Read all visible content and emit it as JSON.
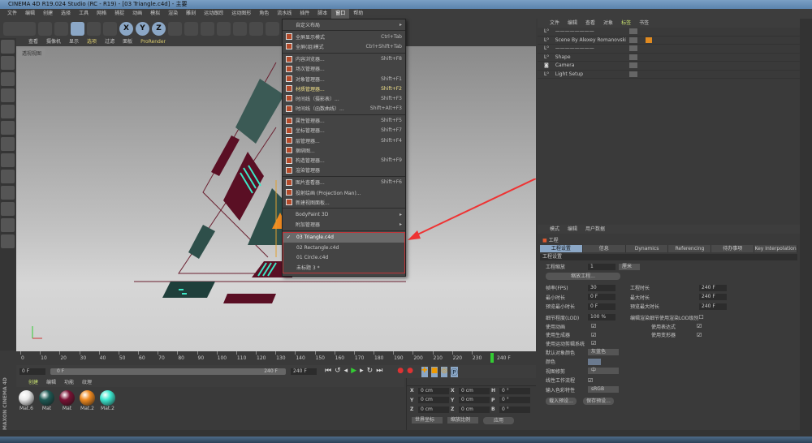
{
  "title": "CINEMA 4D R19.024 Studio (RC - R19) - [03 Triangle.c4d] - 主要",
  "menubar": [
    "文件",
    "编辑",
    "创建",
    "选择",
    "工具",
    "网格",
    "捕捉",
    "动画",
    "模拟",
    "渲染",
    "雕刻",
    "运动跟踪",
    "运动图形",
    "角色",
    "流水线",
    "插件",
    "脚本",
    "窗口",
    "帮助"
  ],
  "active_menu": "窗口",
  "toolbar": {
    "axes": [
      "X",
      "Y",
      "Z"
    ]
  },
  "viewport": {
    "menu": [
      "查看",
      "摄像机",
      "显示",
      "选项",
      "过滤",
      "面板",
      "ProRender"
    ],
    "label": "透视视图",
    "colors": {
      "maroon": "#5a0f24",
      "teal": "#2e4f4a",
      "cyan": "#3de8c6",
      "orange": "#f08a20"
    }
  },
  "window_menu": {
    "groups": [
      [
        {
          "label": "自定义布局",
          "shortcut": "",
          "submenu": true
        }
      ],
      [
        {
          "label": "全屏显示模式",
          "shortcut": "Ctrl+Tab"
        },
        {
          "label": "全屏(组)模式",
          "shortcut": "Ctrl+Shift+Tab"
        }
      ],
      [
        {
          "label": "内容浏览器...",
          "shortcut": "Shift+F8"
        },
        {
          "label": "场次管理器...",
          "shortcut": ""
        },
        {
          "label": "对象管理器...",
          "shortcut": "Shift+F1"
        },
        {
          "label": "材质管理器...",
          "shortcut": "Shift+F2",
          "highlight": true
        },
        {
          "label": "时间线（摄影表）...",
          "shortcut": "Shift+F3"
        },
        {
          "label": "时间线（函数曲线）...",
          "shortcut": "Shift+Alt+F3"
        }
      ],
      [
        {
          "label": "属性管理器...",
          "shortcut": "Shift+F5"
        },
        {
          "label": "坐标管理器...",
          "shortcut": "Shift+F7"
        },
        {
          "label": "层管理器...",
          "shortcut": "Shift+F4"
        },
        {
          "label": "捆绑图...",
          "shortcut": ""
        },
        {
          "label": "构造管理器...",
          "shortcut": "Shift+F9"
        },
        {
          "label": "渲染管理器",
          "shortcut": ""
        }
      ],
      [
        {
          "label": "图片查看器...",
          "shortcut": "Shift+F6"
        },
        {
          "label": "投射绘画 (Projection Man)...",
          "shortcut": ""
        },
        {
          "label": "新建视图面板...",
          "shortcut": ""
        }
      ],
      [
        {
          "label": "BodyPaint 3D",
          "shortcut": "",
          "submenu": true
        },
        {
          "label": "附加管理器",
          "shortcut": "",
          "submenu": true
        }
      ]
    ],
    "files": [
      {
        "label": "03 Triangle.c4d",
        "checked": true
      },
      {
        "label": "02 Rectangle.c4d"
      },
      {
        "label": "01 Circle.c4d"
      },
      {
        "label": "未标题 3 *"
      }
    ]
  },
  "object_manager": {
    "menu": [
      "文件",
      "编辑",
      "查看",
      "对象",
      "标签",
      "书签"
    ],
    "objects": [
      "————————",
      "Scene By Alexey Romanovskiy",
      "————————",
      "Shape",
      "Camera",
      "Light Setup"
    ]
  },
  "attributes": {
    "menu": [
      "模式",
      "编辑",
      "用户数据"
    ],
    "object": "工程",
    "tabs": [
      "工程设置",
      "信息",
      "Dynamics",
      "Referencing",
      "待办事项",
      "Key Interpolation"
    ],
    "section": "工程设置",
    "scale_label": "工程缩放",
    "scale_value": "1",
    "scale_unit": "厘米",
    "scale_button": "缩放工程...",
    "fps_label": "帧率(FPS)",
    "fps": "30",
    "duration_label": "工程时长",
    "duration": "240 F",
    "min_label": "最小时长",
    "min": "0 F",
    "max_label": "最大时长",
    "max": "240 F",
    "pmin_label": "预览最小时长",
    "pmin": "0 F",
    "pmax_label": "预览最大时长",
    "pmax": "240 F",
    "lod_label": "细节程度(LOD)",
    "lod": "100 %",
    "render_lod_label": "编辑渲染细节使用渲染LOD级别",
    "checks": [
      {
        "label": "使用动画",
        "checked": true
      },
      {
        "label": "使用表达式",
        "checked": true
      },
      {
        "label": "使用生成器",
        "checked": true
      },
      {
        "label": "使用变形器",
        "checked": true
      },
      {
        "label": "使用运动剪辑系统",
        "checked": true
      }
    ],
    "objcolor_label": "默认对象颜色",
    "objcolor": "灰蓝色",
    "color_label": "颜色",
    "clip_label": "视图修剪",
    "clip": "中",
    "linear_label": "线性工作流程",
    "linear": true,
    "colorprofile_label": "输入色彩特性",
    "colorprofile": "sRGB",
    "load_preset": "载入预设...",
    "save_preset": "保存预设..."
  },
  "timeline": {
    "ticks": [
      "0",
      "10",
      "20",
      "30",
      "40",
      "50",
      "60",
      "70",
      "80",
      "90",
      "100",
      "110",
      "120",
      "130",
      "140",
      "150",
      "160",
      "170",
      "180",
      "190",
      "200",
      "210",
      "220",
      "230"
    ],
    "end": "240 F",
    "start_field": "0 F",
    "range_start": "0 F",
    "range_end": "240 F",
    "end_field": "240 F"
  },
  "materials": {
    "menu": [
      "创建",
      "编辑",
      "功能",
      "纹理"
    ],
    "items": [
      {
        "name": "Mat.6",
        "color": "#e8e8e8"
      },
      {
        "name": "Mat",
        "color": "#1f5a55"
      },
      {
        "name": "Mat",
        "color": "#7a1234"
      },
      {
        "name": "Mat.2",
        "color": "#f08a20"
      },
      {
        "name": "Mat.2",
        "color": "#3de8d0"
      }
    ],
    "brand": "MAXON CINEMA 4D"
  },
  "coords": {
    "rows": [
      [
        "X",
        "0 cm",
        "X",
        "0 cm",
        "H",
        "0 °"
      ],
      [
        "Y",
        "0 cm",
        "Y",
        "0 cm",
        "P",
        "0 °"
      ],
      [
        "Z",
        "0 cm",
        "Z",
        "0 cm",
        "B",
        "0 °"
      ]
    ],
    "mode": "世界坐标",
    "scale": "缩放比例",
    "apply": "应用"
  }
}
